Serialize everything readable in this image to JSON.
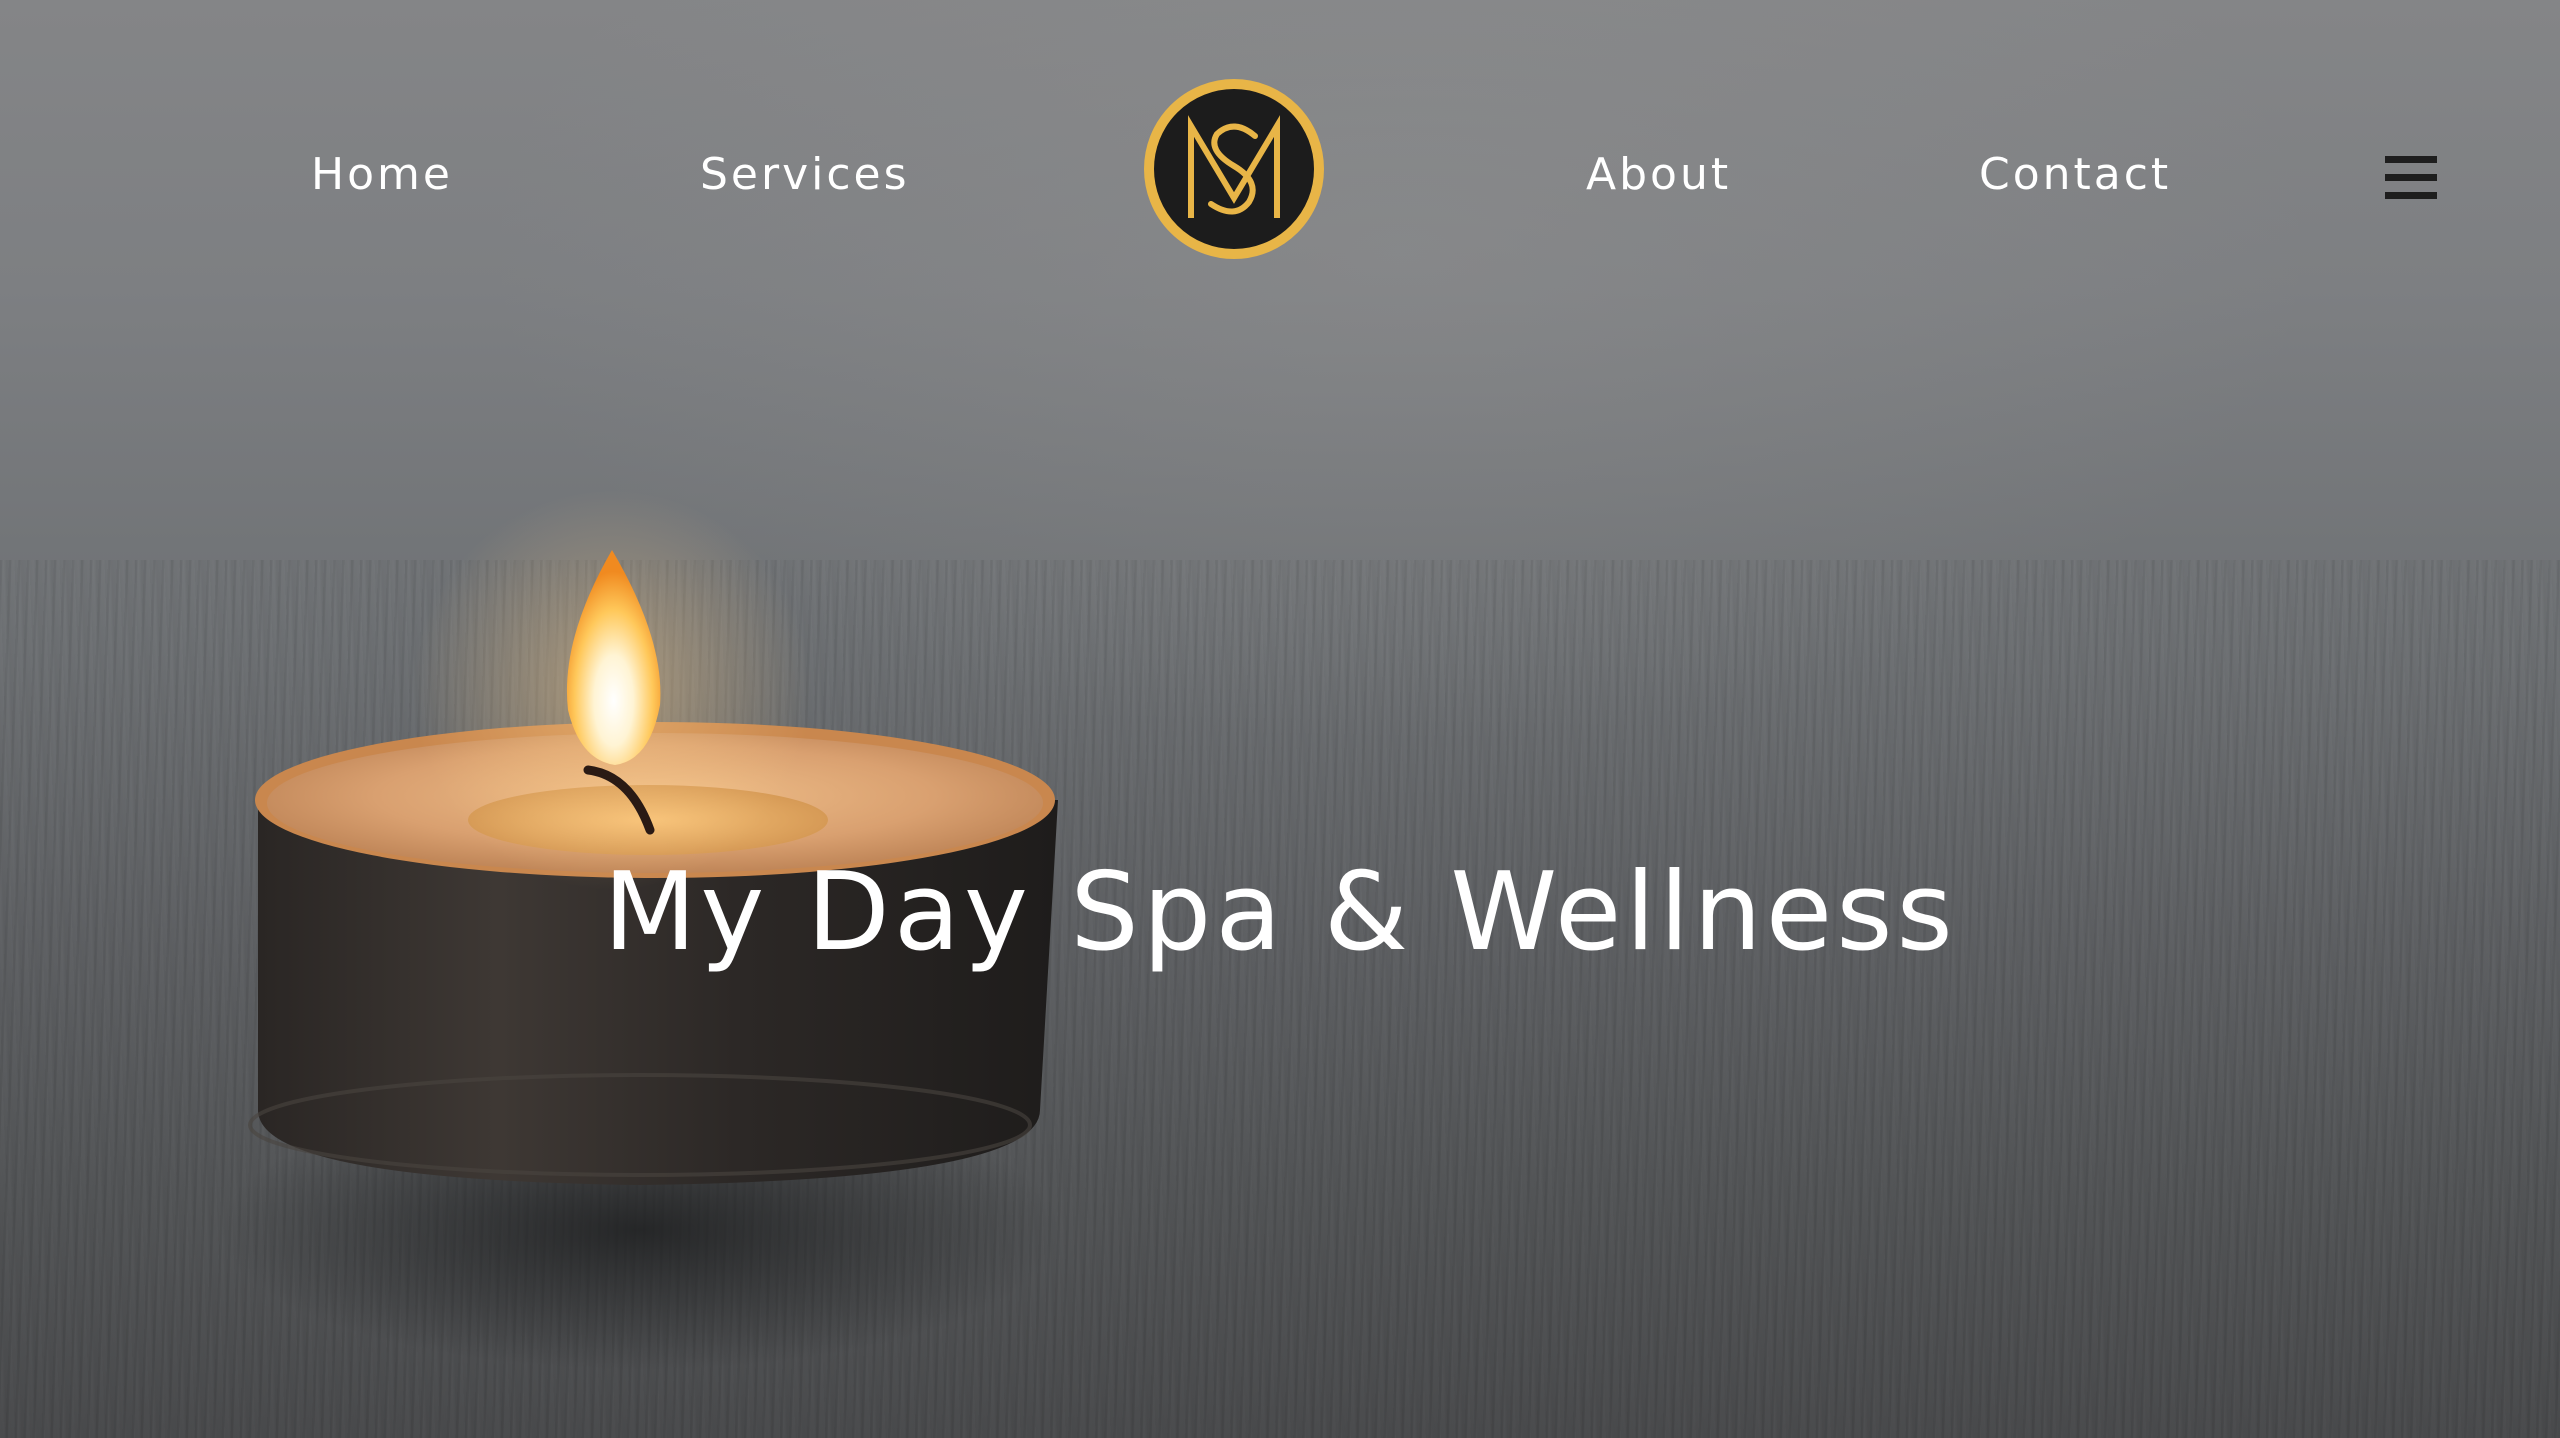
{
  "nav": {
    "links": [
      {
        "label": "Home"
      },
      {
        "label": "Services"
      },
      {
        "label": "About"
      },
      {
        "label": "Contact"
      }
    ],
    "logo": {
      "monogram": "MS",
      "ring_color": "#e8b547",
      "fill_color": "#1c1c1c"
    },
    "menu_icon": "hamburger-menu-icon"
  },
  "hero": {
    "title": "My Day Spa & Wellness",
    "background_image": "tea-light-candle-on-wooden-table"
  },
  "colors": {
    "text": "#ffffff",
    "accent_gold": "#e8b547"
  }
}
